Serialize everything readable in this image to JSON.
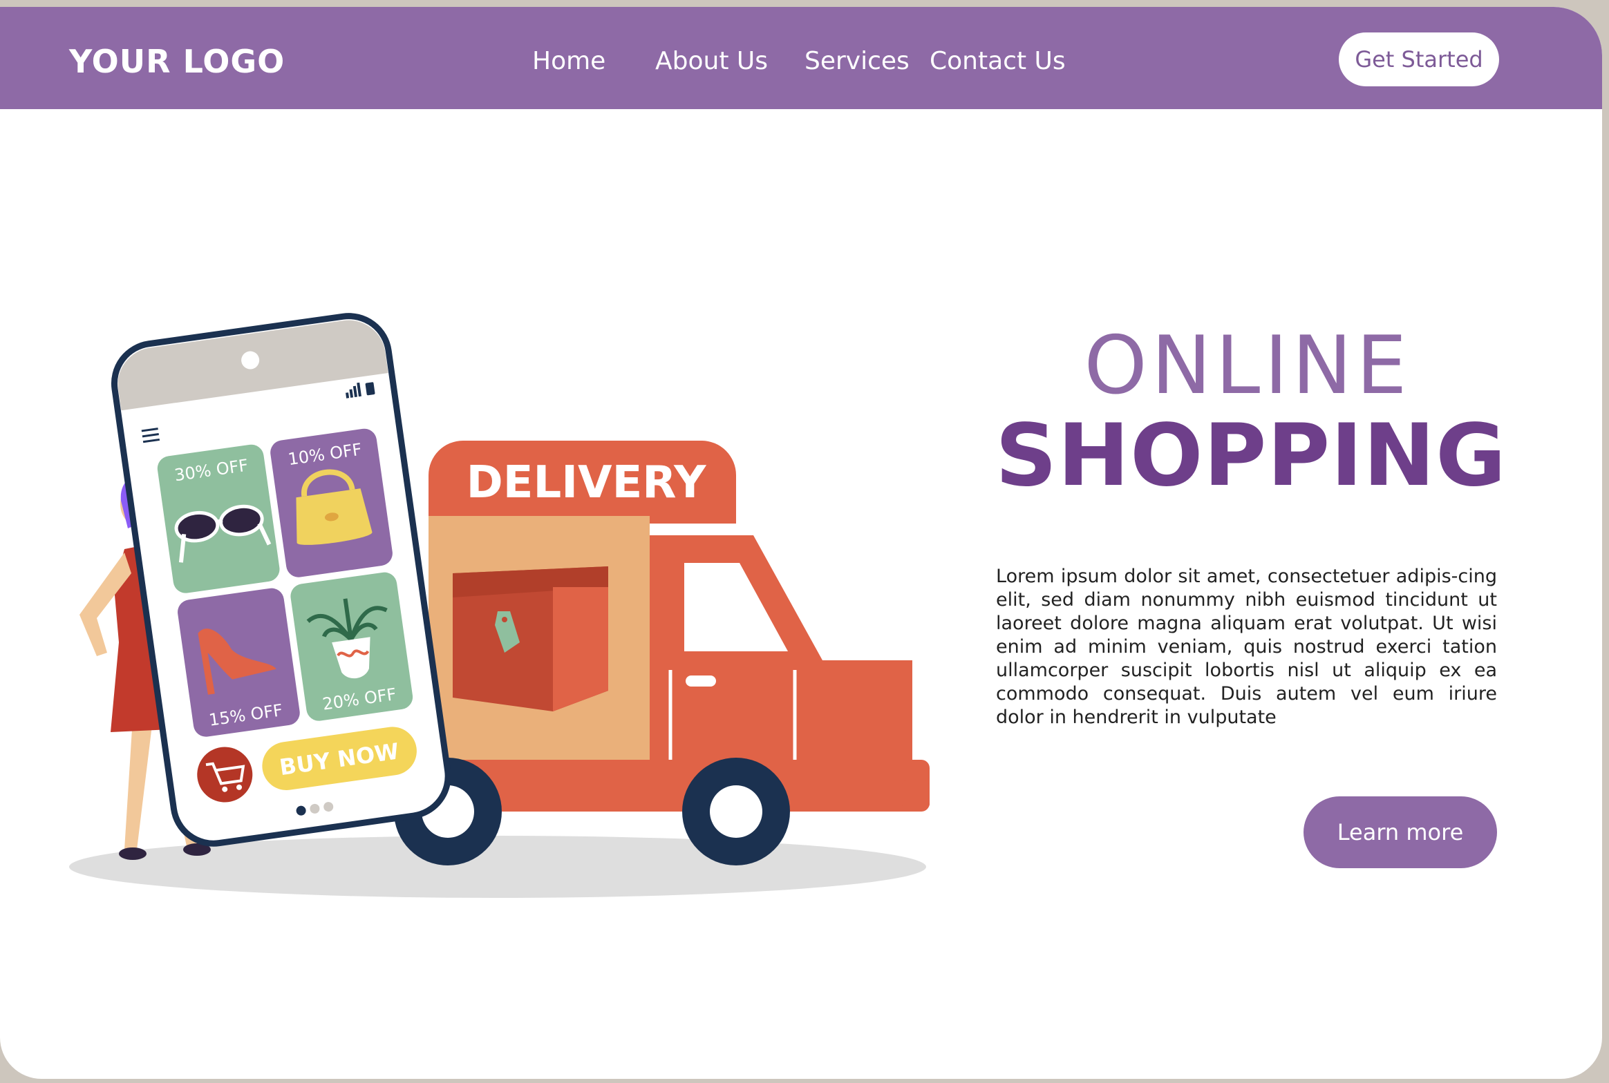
{
  "header": {
    "logo": "YOUR LOGO",
    "nav": [
      "Home",
      "About Us",
      "Services",
      "Contact Us"
    ],
    "cta": "Get Started"
  },
  "hero": {
    "headline_line1": "ONLINE",
    "headline_line2": "SHOPPING",
    "body": "Lorem ipsum dolor sit amet, consectetuer adipis-cing elit, sed diam nonummy nibh euismod tincidunt ut laoreet dolore magna aliquam erat volutpat. Ut wisi enim ad minim veniam, quis nostrud exerci tation ullamcorper suscipit lobortis nisl ut aliquip ex ea commodo consequat. Duis autem vel eum iriure dolor in hendrerit in vulputate",
    "button": "Learn more"
  },
  "illustration": {
    "truck_label": "DELIVERY",
    "phone_tiles": [
      "30% OFF",
      "10% OFF",
      "15% OFF",
      "20% OFF"
    ],
    "phone_button": "BUY NOW"
  },
  "colors": {
    "accent": "#8e6aa6",
    "accent_dark": "#6e3f8a",
    "truck": "#e06347",
    "tile_green": "#8fbf9e",
    "tile_purple": "#8e6aa6",
    "navy": "#1b3150"
  }
}
